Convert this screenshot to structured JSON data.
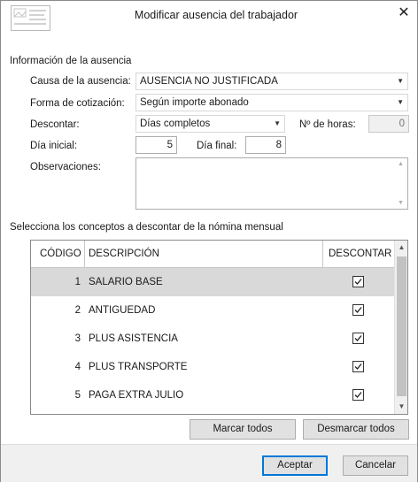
{
  "window": {
    "title": "Modificar ausencia del trabajador",
    "close_glyph": "✕"
  },
  "absence": {
    "section_title": "Información de la ausencia",
    "cause_label": "Causa de la ausencia:",
    "cause_value": "AUSENCIA NO JUSTIFICADA",
    "contribution_label": "Forma de cotización:",
    "contribution_value": "Según importe abonado",
    "deduct_label": "Descontar:",
    "deduct_value": "Días completos",
    "hours_label": "Nº de horas:",
    "hours_value": "0",
    "start_label": "Día inicial:",
    "start_value": "5",
    "end_label": "Día final:",
    "end_value": "8",
    "notes_label": "Observaciones:",
    "notes_value": ""
  },
  "concepts": {
    "section_title": "Selecciona los conceptos a descontar de la nómina mensual",
    "columns": {
      "code": "CÓDIGO",
      "description": "DESCRIPCIÓN",
      "deduct": "DESCONTAR"
    },
    "rows": [
      {
        "code": "1",
        "description": "SALARIO BASE",
        "checked": true,
        "selected": true
      },
      {
        "code": "2",
        "description": "ANTIGUEDAD",
        "checked": true,
        "selected": false
      },
      {
        "code": "3",
        "description": "PLUS ASISTENCIA",
        "checked": true,
        "selected": false
      },
      {
        "code": "4",
        "description": "PLUS TRANSPORTE",
        "checked": true,
        "selected": false
      },
      {
        "code": "5",
        "description": "PAGA EXTRA JULIO",
        "checked": true,
        "selected": false
      }
    ],
    "mark_all": "Marcar todos",
    "unmark_all": "Desmarcar todos"
  },
  "footer": {
    "accept": "Aceptar",
    "cancel": "Cancelar"
  },
  "colors": {
    "selected_row": "#d9d9d9",
    "default_button_border": "#0078d7",
    "panel": "#f0f0f0"
  },
  "icons": {
    "app": "form-card-icon",
    "dropdown": "chevron-down-icon",
    "check": "checkmark-icon"
  }
}
